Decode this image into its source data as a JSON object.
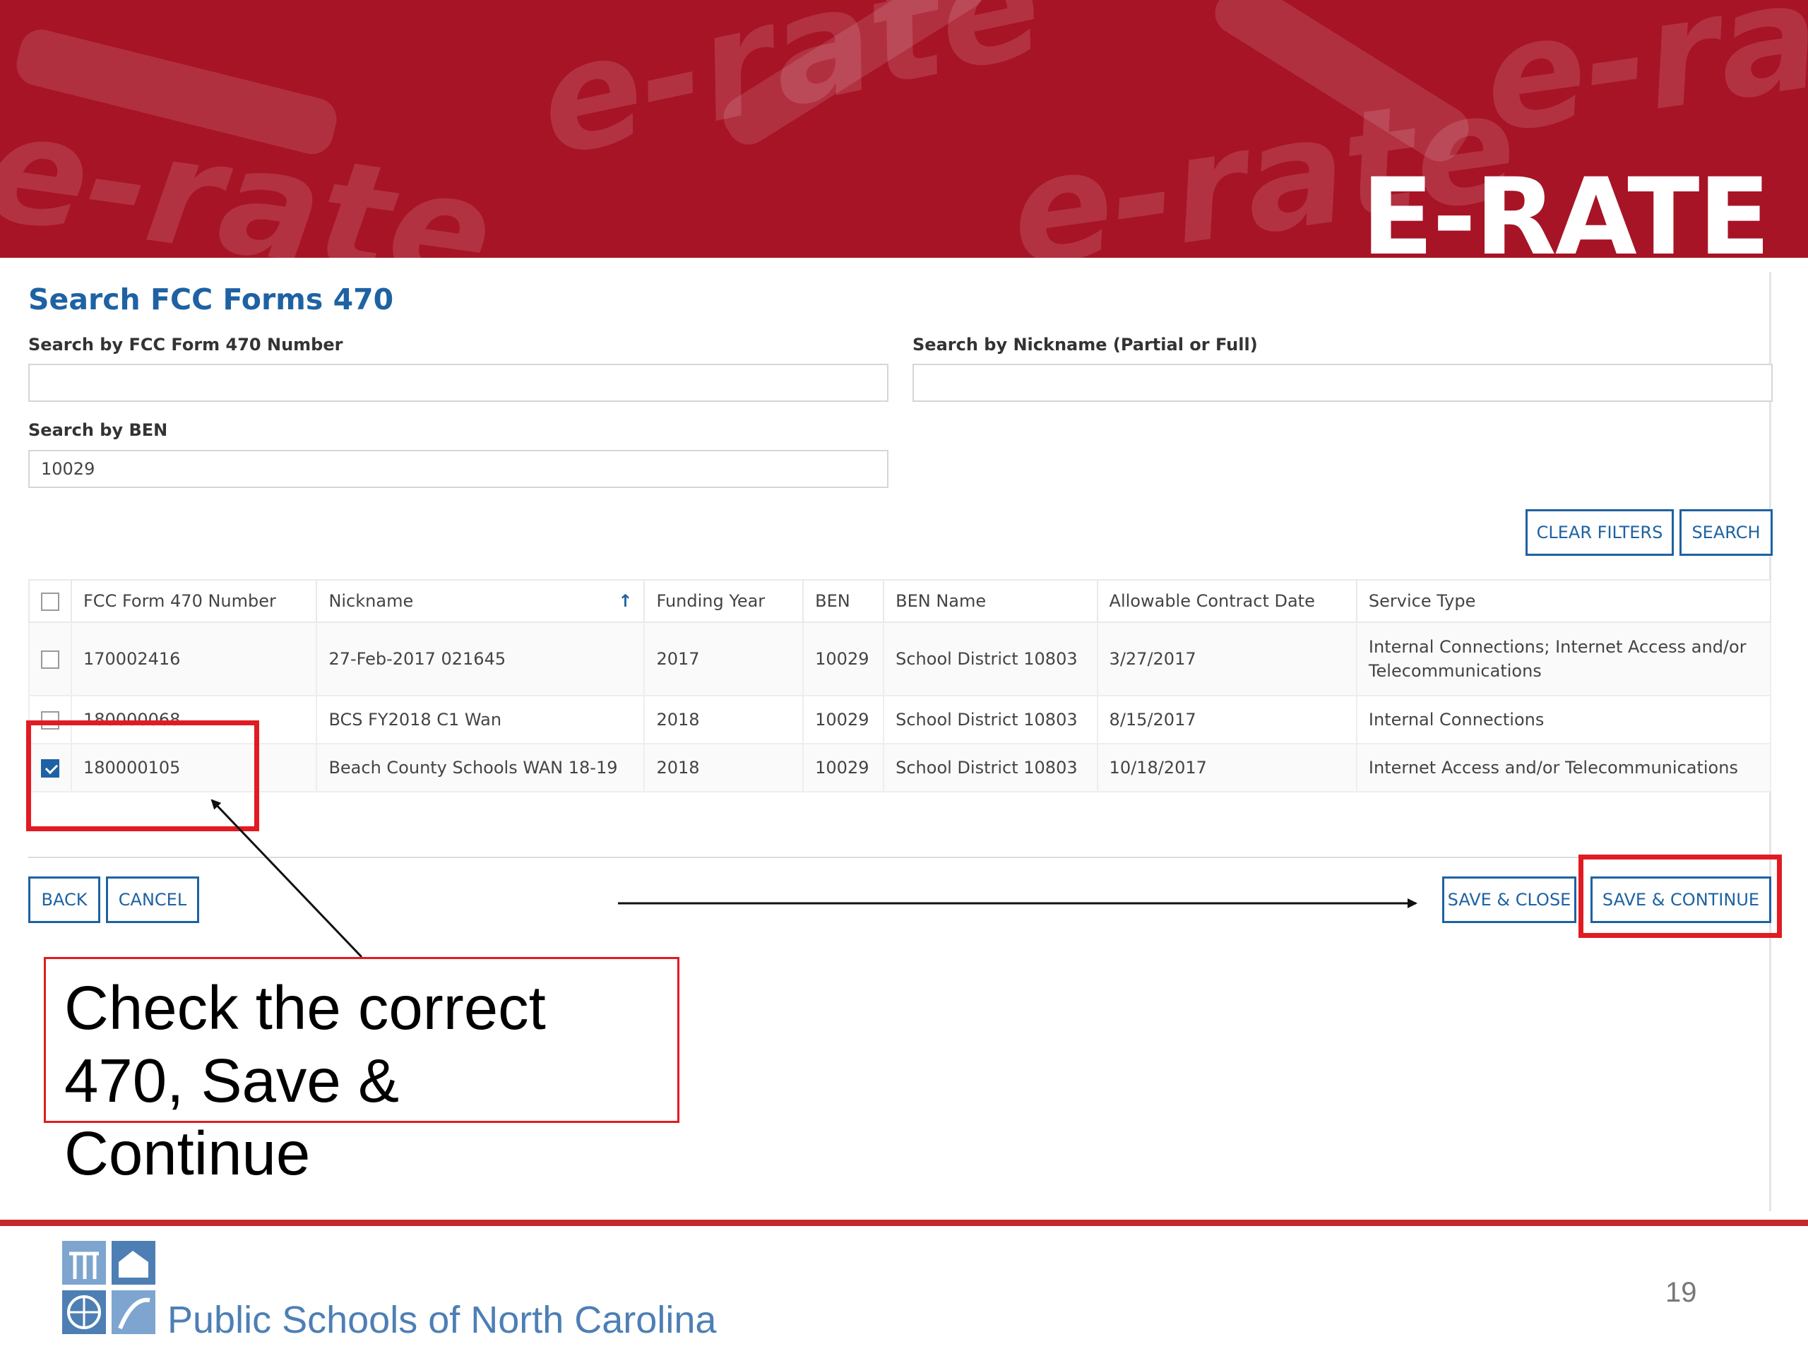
{
  "banner": {
    "brand": "E-RATE",
    "watermark": "e-rate"
  },
  "form": {
    "title": "Search FCC Forms 470",
    "form470_label": "Search by FCC Form 470 Number",
    "form470_value": "",
    "nickname_label": "Search by Nickname (Partial or Full)",
    "nickname_value": "",
    "ben_label": "Search by BEN",
    "ben_value": "10029",
    "clear_filters": "CLEAR FILTERS",
    "search": "SEARCH"
  },
  "table": {
    "headers": [
      "FCC Form 470 Number",
      "Nickname",
      "Funding Year",
      "BEN",
      "BEN Name",
      "Allowable Contract Date",
      "Service Type"
    ],
    "rows": [
      {
        "checked": false,
        "number": "170002416",
        "nickname": "27-Feb-2017 021645",
        "year": "2017",
        "ben": "10029",
        "ben_name": "School District 10803",
        "date": "3/27/2017",
        "service": "Internal Connections; Internet Access and/or Telecommunications"
      },
      {
        "checked": false,
        "number": "180000068",
        "nickname": "BCS FY2018 C1 Wan",
        "year": "2018",
        "ben": "10029",
        "ben_name": "School District 10803",
        "date": "8/15/2017",
        "service": "Internal Connections"
      },
      {
        "checked": true,
        "number": "180000105",
        "nickname": "Beach County Schools WAN 18-19",
        "year": "2018",
        "ben": "10029",
        "ben_name": "School District 10803",
        "date": "10/18/2017",
        "service": "Internet Access and/or Telecommunications"
      }
    ]
  },
  "actions": {
    "back": "BACK",
    "cancel": "CANCEL",
    "save_close": "SAVE & CLOSE",
    "save_continue": "SAVE & CONTINUE"
  },
  "annotation": {
    "line1": "Check the correct",
    "line2": "470, Save & Continue"
  },
  "footer": {
    "org": "Public Schools of North Carolina",
    "page": "19"
  },
  "colors": {
    "banner": "#a71426",
    "accent": "#1e62a3",
    "highlight": "#e11b22",
    "footer_line": "#c42a2b",
    "footer_text": "#4d7fb5"
  }
}
